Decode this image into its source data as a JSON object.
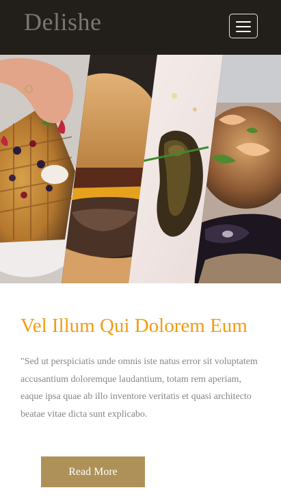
{
  "navbar": {
    "brand": "Delishe",
    "menu_icon": "hamburger-menu-icon"
  },
  "hero": {
    "panels": [
      "waffle",
      "burger",
      "sauce-plate",
      "seafood"
    ]
  },
  "article": {
    "headline": "Vel Illum Qui Dolorem Eum",
    "body": "\"Sed ut perspiciatis unde omnis iste natus error sit voluptatem accusantium doloremque laudantium, totam rem aperiam, eaque ipsa quae ab illo inventore veritatis et quasi architecto beatae vitae dicta sunt explicabo.",
    "cta_label": "Read More"
  },
  "colors": {
    "navbar_bg": "#221e1a",
    "brand_text": "#7a7670",
    "headline": "#f39c12",
    "body_text": "#8a8580",
    "button_bg": "#ad9158",
    "button_text": "#ffffff"
  }
}
